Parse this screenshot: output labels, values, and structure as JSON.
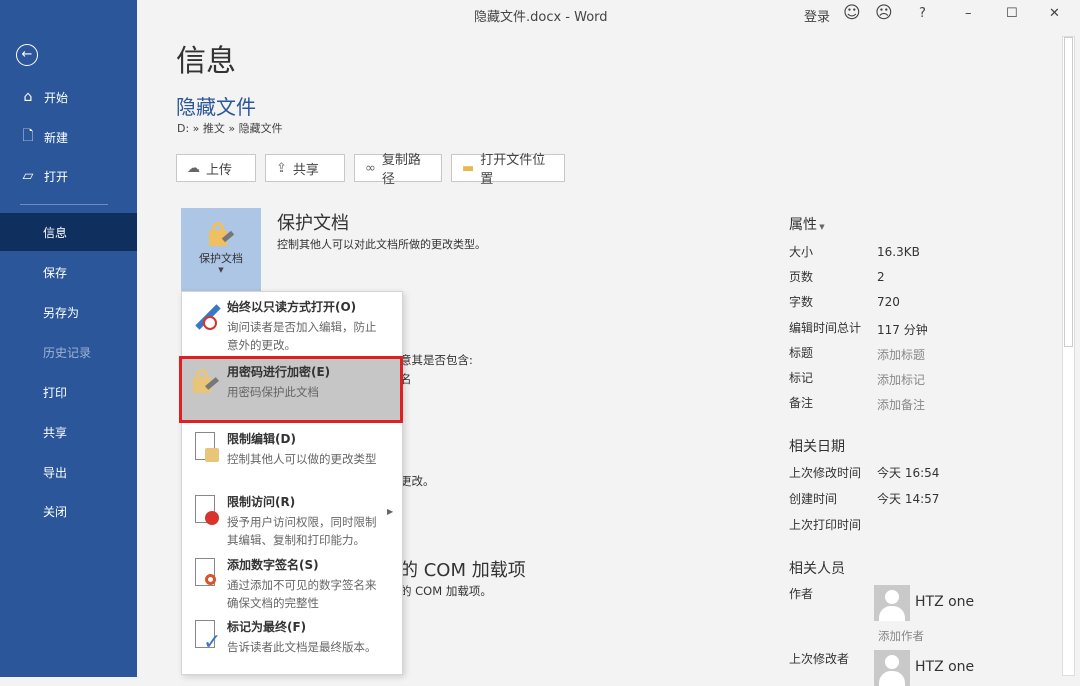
{
  "window": {
    "title": "隐藏文件.docx  -  Word",
    "signin": "登录",
    "help": "?"
  },
  "sidebar": {
    "items": [
      {
        "label": "开始"
      },
      {
        "label": "新建"
      },
      {
        "label": "打开"
      },
      {
        "label": "信息"
      },
      {
        "label": "保存"
      },
      {
        "label": "另存为"
      },
      {
        "label": "历史记录"
      },
      {
        "label": "打印"
      },
      {
        "label": "共享"
      },
      {
        "label": "导出"
      },
      {
        "label": "关闭"
      }
    ]
  },
  "main": {
    "heading": "信息",
    "doc_name": "隐藏文件",
    "breadcrumb": "D: » 推文 » 隐藏文件",
    "buttons": {
      "upload": "上传",
      "share": "共享",
      "copy_path": "复制路径",
      "open_location": "打开文件位置"
    },
    "protect": {
      "button": "保护文档",
      "title": "保护文档",
      "desc": "控制其他人可以对此文档所做的更改类型。"
    },
    "hidden_fragments": [
      "意其是否包含:",
      "名",
      "更改。",
      "的 COM 加载项",
      "的 COM 加载项。"
    ]
  },
  "menu": {
    "items": [
      {
        "title": "始终以只读方式打开(O)",
        "desc": "询问读者是否加入编辑，防止意外的更改。"
      },
      {
        "title": "用密码进行加密(E)",
        "desc": "用密码保护此文档"
      },
      {
        "title": "限制编辑(D)",
        "desc": "控制其他人可以做的更改类型"
      },
      {
        "title": "限制访问(R)",
        "desc": "授予用户访问权限，同时限制其编辑、复制和打印能力。"
      },
      {
        "title": "添加数字签名(S)",
        "desc": "通过添加不可见的数字签名来确保文档的完整性"
      },
      {
        "title": "标记为最终(F)",
        "desc": "告诉读者此文档是最终版本。"
      }
    ]
  },
  "properties": {
    "header": "属性",
    "rows": [
      {
        "label": "大小",
        "value": "16.3KB"
      },
      {
        "label": "页数",
        "value": "2"
      },
      {
        "label": "字数",
        "value": "720"
      },
      {
        "label": "编辑时间总计",
        "value": "117 分钟"
      },
      {
        "label": "标题",
        "value": "添加标题"
      },
      {
        "label": "标记",
        "value": "添加标记"
      },
      {
        "label": "备注",
        "value": "添加备注"
      }
    ]
  },
  "dates": {
    "header": "相关日期",
    "rows": [
      {
        "label": "上次修改时间",
        "value": "今天 16:54"
      },
      {
        "label": "创建时间",
        "value": "今天 14:57"
      },
      {
        "label": "上次打印时间",
        "value": ""
      }
    ]
  },
  "people": {
    "header": "相关人员",
    "author_label": "作者",
    "author": "HTZ one",
    "add_author": "添加作者",
    "modifier_label": "上次修改者",
    "modifier": "HTZ one"
  }
}
